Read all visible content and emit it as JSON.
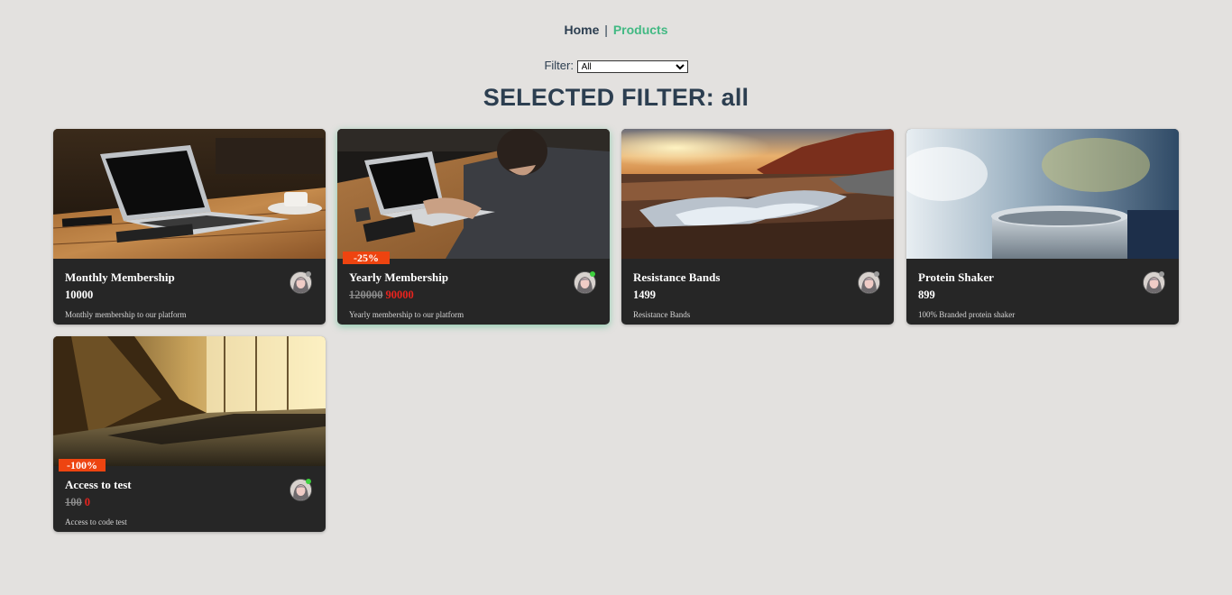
{
  "nav": {
    "home": "Home",
    "separator": "|",
    "products": "Products"
  },
  "filter": {
    "label": "Filter:",
    "selected": "All"
  },
  "heading": "SELECTED FILTER: all",
  "colors": {
    "accent": "#42b983",
    "text": "#2c3e50",
    "badge": "#ee4410",
    "sale_price": "#e8231e",
    "online": "#3ecf3e"
  },
  "products": [
    {
      "name": "Monthly Membership",
      "price": "10000",
      "old_price": "",
      "new_price": "",
      "discount": "",
      "description": "Monthly membership to our platform",
      "online": false
    },
    {
      "name": "Yearly Membership",
      "price": "",
      "old_price": "120000",
      "new_price": "90000",
      "discount": "-25%",
      "description": "Yearly membership to our platform",
      "online": true
    },
    {
      "name": "Resistance Bands",
      "price": "1499",
      "old_price": "",
      "new_price": "",
      "discount": "",
      "description": "Resistance Bands",
      "online": false
    },
    {
      "name": "Protein Shaker",
      "price": "899",
      "old_price": "",
      "new_price": "",
      "discount": "",
      "description": "100% Branded protein shaker",
      "online": false
    },
    {
      "name": "Access to test",
      "price": "",
      "old_price": "100",
      "new_price": "0",
      "discount": "-100%",
      "description": "Access to code test",
      "online": true
    }
  ]
}
